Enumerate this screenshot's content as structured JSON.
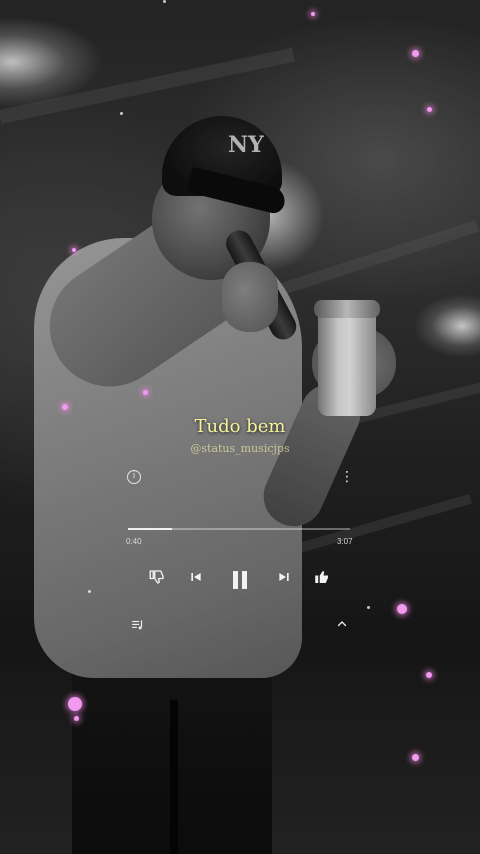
{
  "lyric": {
    "line": "Tudo bem",
    "handle": "@status_musicjps"
  },
  "player": {
    "icons": {
      "info": "info-icon",
      "more": "more-vertical-icon",
      "dislike": "thumbs-down-icon",
      "previous": "skip-previous-icon",
      "play_pause": "pause-icon",
      "next": "skip-next-icon",
      "like": "thumbs-up-icon",
      "queue": "queue-music-icon",
      "expand": "chevron-up-icon"
    },
    "elapsed": "0:40",
    "duration": "3:07",
    "progress_fraction": 0.2,
    "info_glyph": "i",
    "more_glyph": "⋮",
    "dislike_glyph": "👎",
    "previous_glyph": "⏮",
    "pause_glyph": "❚❚",
    "next_glyph": "⏭",
    "like_glyph": "👍",
    "queue_glyph": "≡",
    "chevron_glyph": "⌃"
  },
  "colors": {
    "lyric_text": "#f6f29a",
    "particle": "#f19af0",
    "ui_white": "#f2f2f2"
  }
}
